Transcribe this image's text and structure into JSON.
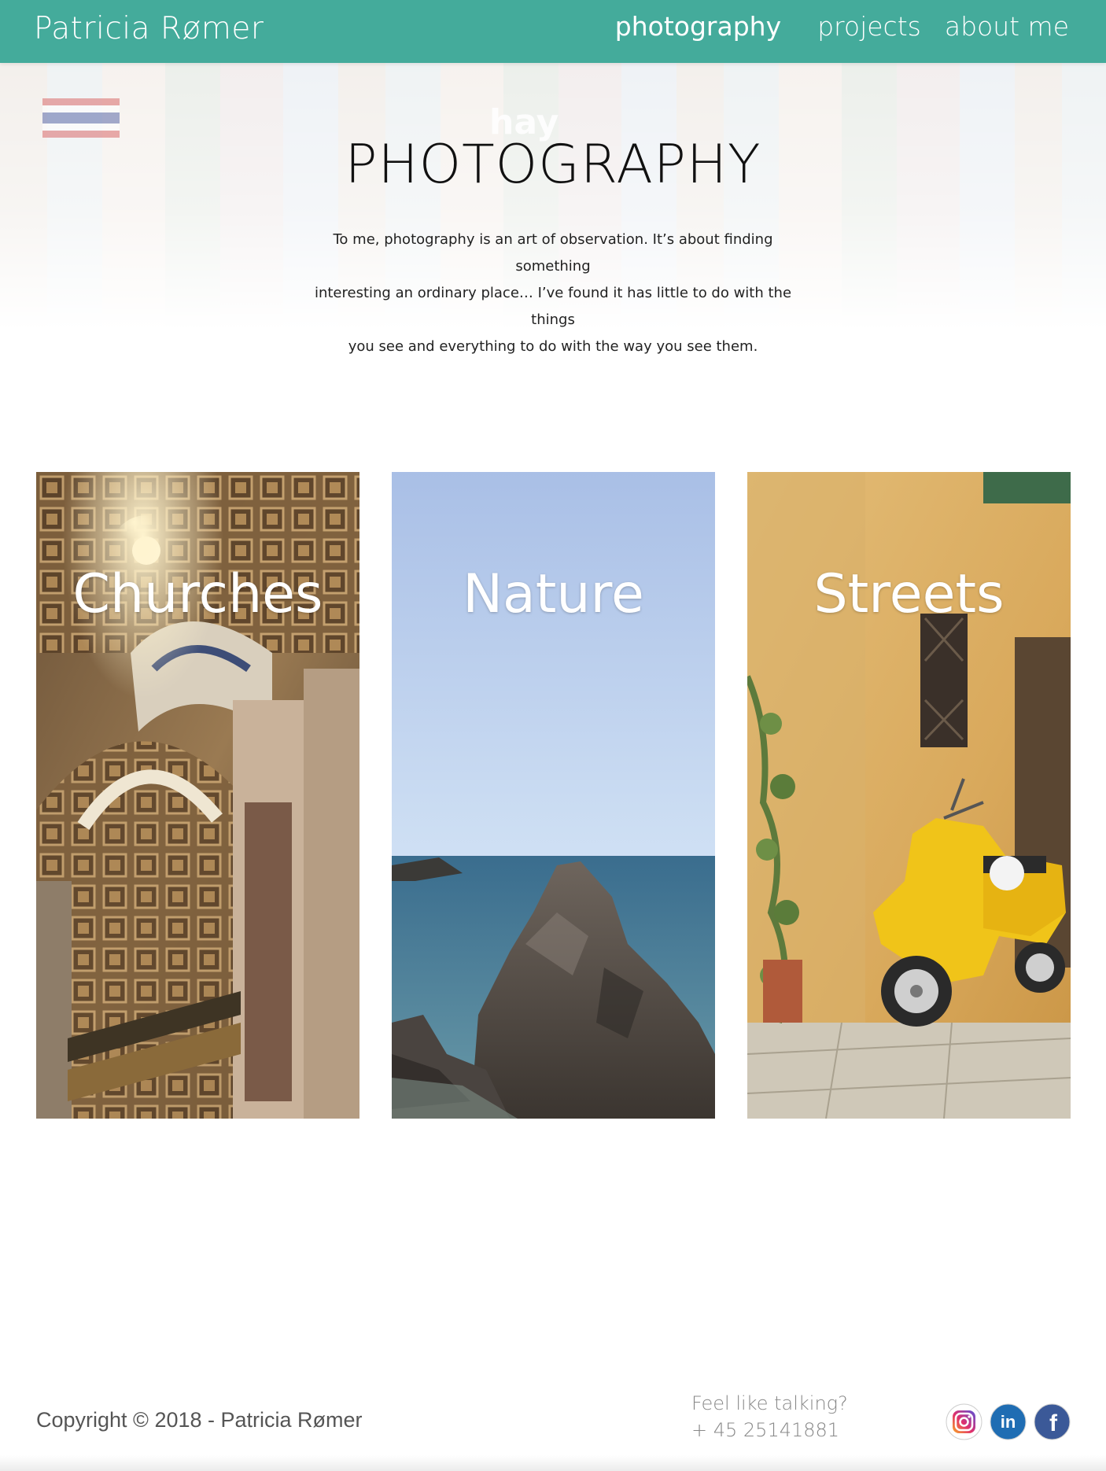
{
  "header": {
    "brand": "Patricia Rømer",
    "nav": [
      {
        "label": "photography",
        "active": true
      },
      {
        "label": "projects",
        "active": false
      },
      {
        "label": "about me",
        "active": false
      }
    ]
  },
  "hero": {
    "title": "PHOTOGRAPHY",
    "intro_lines": [
      "To me, photography is an art of observation. It’s about finding something",
      "interesting an ordinary place… I’ve found it has little to do with the things",
      "you see and everything to do with the way you see them."
    ],
    "background_text": "hay"
  },
  "categories": [
    {
      "label": "Churches",
      "icon": "church-interior-photo"
    },
    {
      "label": "Nature",
      "icon": "sea-rock-photo"
    },
    {
      "label": "Streets",
      "icon": "yellow-scooter-photo"
    }
  ],
  "footer": {
    "copyright": "Copyright © 2018 - Patricia Rømer",
    "contact_prompt": "Feel like talking?",
    "phone": "+ 45 25141881",
    "social": [
      {
        "name": "instagram-icon",
        "color": "#c13584"
      },
      {
        "name": "linkedin-icon",
        "color": "#1f6db3",
        "text": "in"
      },
      {
        "name": "facebook-icon",
        "color": "#3b5998",
        "text": "f"
      }
    ]
  },
  "colors": {
    "header_bg": "#44ab9b",
    "text": "#222222"
  }
}
